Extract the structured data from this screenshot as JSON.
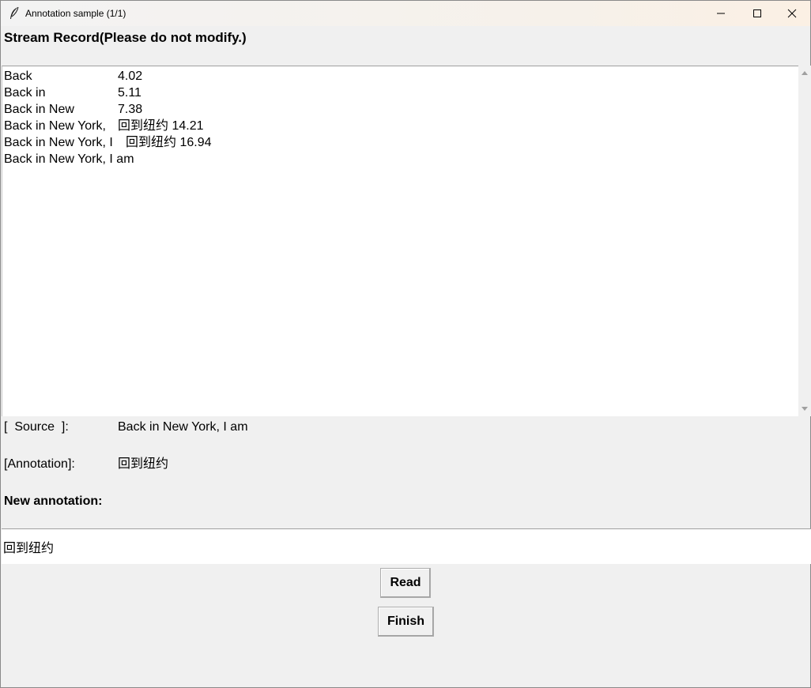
{
  "window": {
    "title": "Annotation sample (1/1)"
  },
  "heading": "Stream Record(Please do not modify.)",
  "stream_record": {
    "rows": [
      {
        "source": "Back",
        "value": "4.02"
      },
      {
        "source": "Back in",
        "value": "5.11"
      },
      {
        "source": "Back in New",
        "value": "7.38"
      },
      {
        "source": "Back in New York,",
        "value": "回到纽约 14.21"
      },
      {
        "source": "Back in New York, I",
        "value": "回到纽约 16.94"
      },
      {
        "source": "Back in New York, I am",
        "value": ""
      }
    ]
  },
  "source_field": {
    "label": "[  Source  ]:",
    "value": "Back in New York, I am"
  },
  "annotation_field": {
    "label": "[Annotation]:",
    "value": "回到纽约"
  },
  "new_annotation": {
    "label": "New annotation:",
    "value": "回到纽约"
  },
  "buttons": {
    "read": "Read",
    "finish": "Finish"
  }
}
